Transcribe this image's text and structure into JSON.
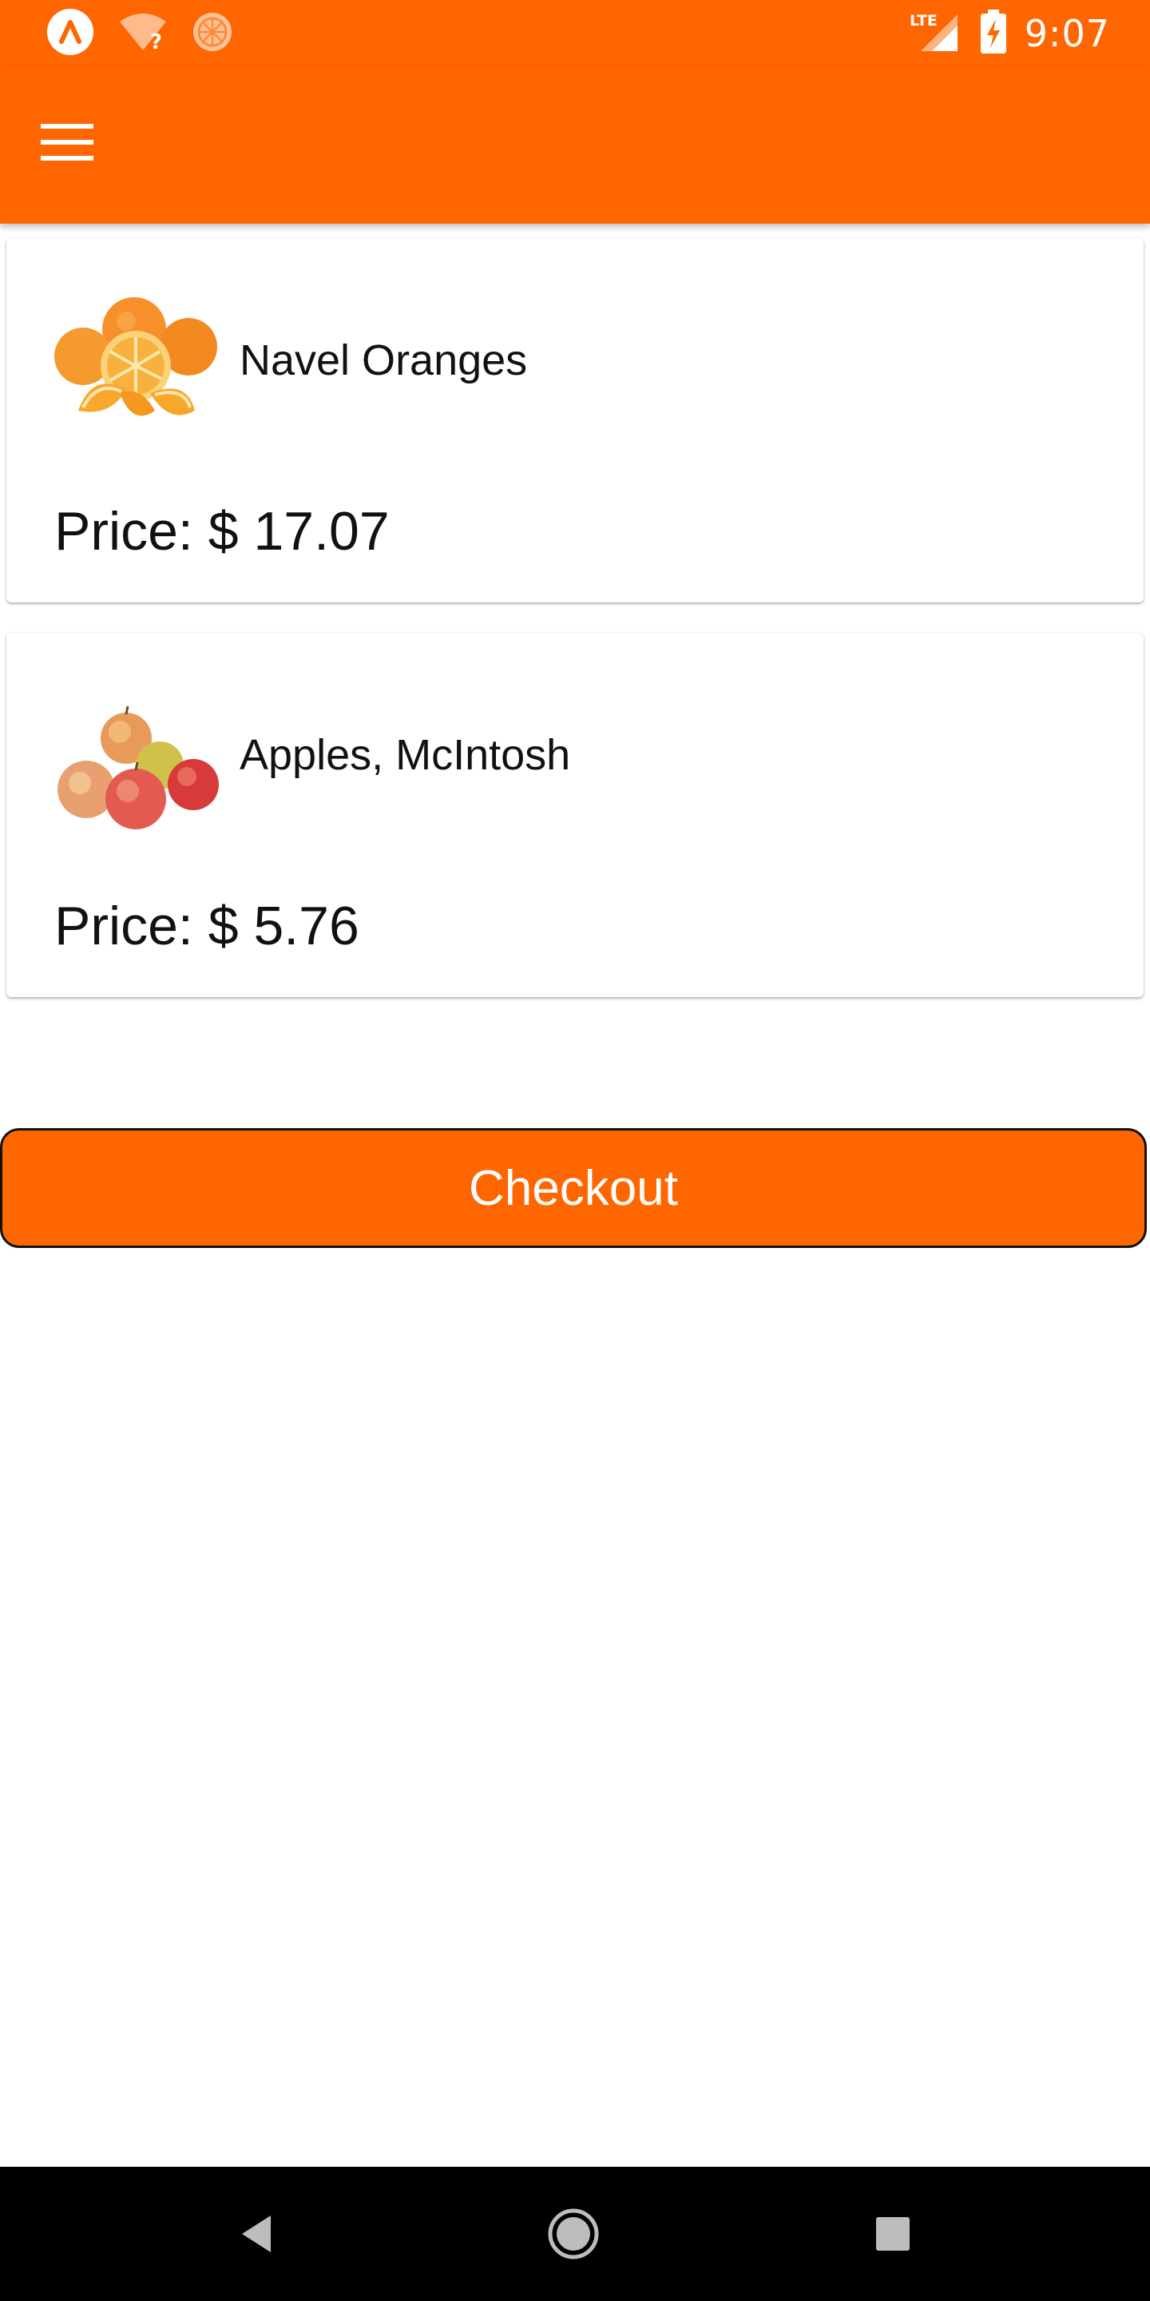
{
  "status_bar": {
    "time": "9:07",
    "network_label": "LTE",
    "left_icons": [
      "expo-icon",
      "wifi-unknown-icon",
      "orange-notification-icon"
    ],
    "right_icons": [
      "lte-signal-icon",
      "battery-charging-icon"
    ]
  },
  "app_bar": {
    "menu_icon": "hamburger-menu-icon",
    "color": "#ff6600"
  },
  "products": [
    {
      "name": "Navel Oranges",
      "price_label": "Price:",
      "currency": "$",
      "price": "17.07",
      "image_icon": "oranges-image"
    },
    {
      "name": "Apples, McIntosh",
      "price_label": "Price:",
      "currency": "$",
      "price": "5.76",
      "image_icon": "apples-image"
    }
  ],
  "checkout": {
    "label": "Checkout",
    "color": "#ff6600"
  },
  "nav_bar": {
    "buttons": [
      "back-icon",
      "home-icon",
      "recents-icon"
    ]
  }
}
